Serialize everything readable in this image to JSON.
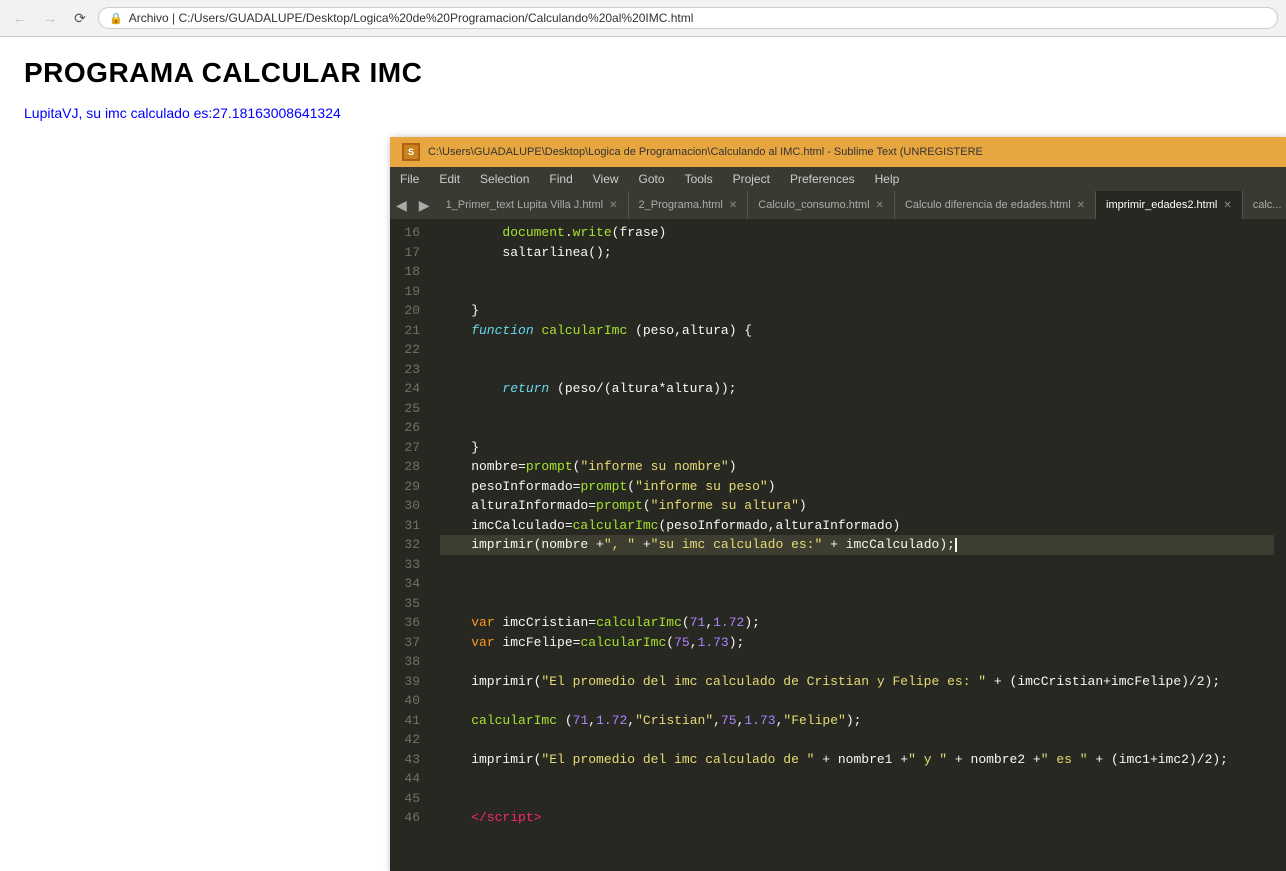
{
  "browser": {
    "back_disabled": true,
    "forward_disabled": true,
    "address": "C:/Users/GUADALUPE/Desktop/Logica%20de%20Programacion/Calculando%20al%20IMC.html",
    "address_display": "Archivo  |  C:/Users/GUADALUPE/Desktop/Logica%20de%20Programacion/Calculando%20al%20IMC.html"
  },
  "page": {
    "title": "PROGRAMA CALCULAR IMC",
    "subtitle": "LupitaVJ, su imc calculado es:27.18163008641324"
  },
  "sublime": {
    "logo": "S",
    "title": "C:\\Users\\GUADALUPE\\Desktop\\Logica de Programacion\\Calculando al IMC.html - Sublime Text (UNREGISTERE",
    "menu_items": [
      "File",
      "Edit",
      "Selection",
      "Find",
      "View",
      "Goto",
      "Tools",
      "Project",
      "Preferences",
      "Help"
    ],
    "tabs": [
      {
        "label": "1_Primer_text Lupita Villa J.html",
        "active": false
      },
      {
        "label": "2_Programa.html",
        "active": false
      },
      {
        "label": "Calculo_consumo.html",
        "active": false
      },
      {
        "label": "Calculo diferencia de edades.html",
        "active": false
      },
      {
        "label": "imprimir_edades2.html",
        "active": true
      },
      {
        "label": "calc...",
        "active": false
      }
    ]
  }
}
